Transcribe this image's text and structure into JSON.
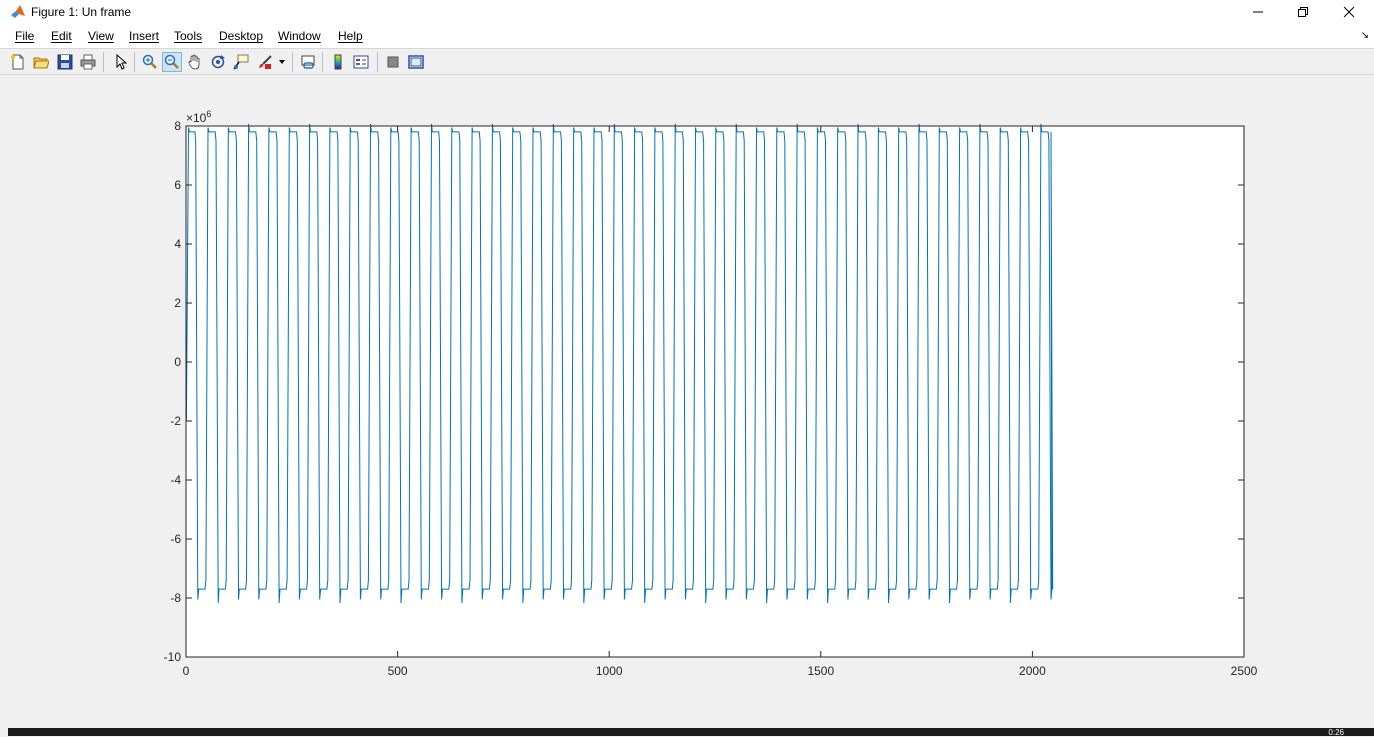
{
  "window": {
    "title": "Figure 1: Un frame",
    "controls": {
      "minimize": "—",
      "maximize": "❐",
      "close": "✕"
    }
  },
  "menubar": {
    "items": [
      "File",
      "Edit",
      "View",
      "Insert",
      "Tools",
      "Desktop",
      "Window",
      "Help"
    ],
    "dock_glyph": "↘"
  },
  "toolbar": {
    "buttons": [
      "new-figure-icon",
      "open-file-icon",
      "save-icon",
      "print-icon",
      "edit-plot-arrow-icon",
      "zoom-in-icon",
      "zoom-out-icon",
      "pan-hand-icon",
      "rotate-3d-icon",
      "data-cursor-icon",
      "brush-icon",
      "brush-dropdown-icon",
      "link-plot-icon",
      "insert-colorbar-icon",
      "insert-legend-icon",
      "hide-plot-tools-icon",
      "show-plot-tools-icon"
    ],
    "active_button": "zoom-out-icon"
  },
  "chart_data": {
    "type": "line",
    "title": "",
    "xlabel": "",
    "ylabel": "",
    "xlim": [
      0,
      2500
    ],
    "ylim": [
      -10,
      8
    ],
    "y_exponent_label": "×10",
    "y_exponent_power": "6",
    "x_ticks": [
      0,
      500,
      1000,
      1500,
      2000,
      2500
    ],
    "x_tick_labels": [
      "0",
      "500",
      "1000",
      "1500",
      "2000",
      "2500"
    ],
    "y_ticks": [
      8,
      6,
      4,
      2,
      0,
      -2,
      -4,
      -6,
      -8,
      -10
    ],
    "y_tick_labels": [
      "8",
      "6",
      "4",
      "2",
      "0",
      "-2",
      "-4",
      "-6",
      "-8",
      "-10"
    ],
    "grid": false,
    "series": [
      {
        "color": "#0072bd",
        "x_start": 1,
        "x_end": 2048,
        "period": 48,
        "high_level": 7.8,
        "low_level": -7.7,
        "peak_high": 7.95,
        "peak_low": -8.05,
        "first_value": -2.0,
        "last_value": -7.7
      }
    ]
  },
  "taskbar": {
    "clock": "0:26"
  }
}
